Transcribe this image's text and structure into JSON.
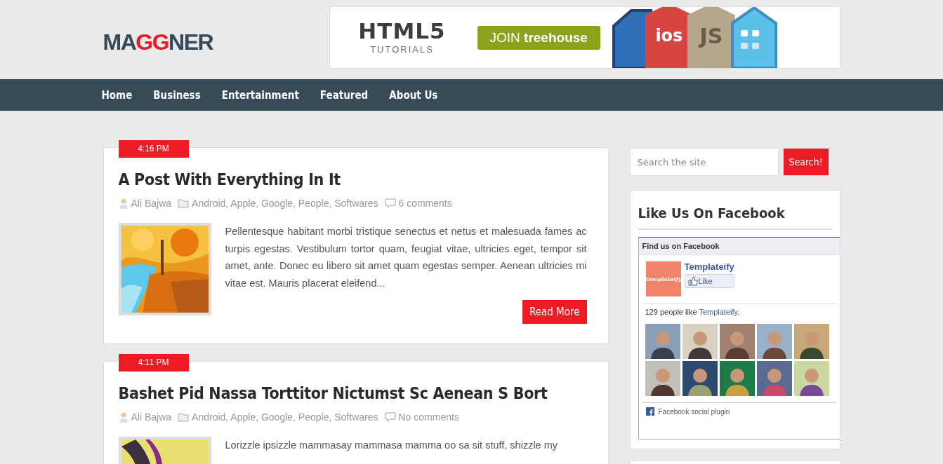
{
  "logo": [
    {
      "text": "MA",
      "accent": false
    },
    {
      "text": "GG",
      "accent": true
    },
    {
      "text": "NER",
      "accent": false
    }
  ],
  "banner": {
    "title": "HTML5",
    "subtitle": "TUTORIALS",
    "button": "JOIN **treehouse**",
    "badges": [
      {
        "text": "ios",
        "color": "#d64541"
      },
      {
        "text": "JS",
        "color": "#b5a68c"
      }
    ]
  },
  "nav": [
    {
      "label": "Home"
    },
    {
      "label": "Business"
    },
    {
      "label": "Entertainment"
    },
    {
      "label": "Featured"
    },
    {
      "label": "About Us"
    }
  ],
  "posts": [
    {
      "time": "4:16 PM",
      "title": "A Post With Everything In It",
      "author": "Ali Bajwa",
      "categories": "Android, Apple, Google, People, Softwares",
      "comments": "6 comments",
      "excerpt": "Pellentesque habitant morbi tristique senectus et netus et malesuada fames ac turpis egestas. Vestibulum tortor quam, feugiat vitae, ultricies eget, tempor sit amet, ante. Donec eu libero sit amet quam egestas semper. Aenean ultricies mi vitae est. Mauris placerat eleifend...",
      "read_more": "Read More",
      "thumb": {
        "kind": "autumn"
      }
    },
    {
      "time": "4:11 PM",
      "title": "Bashet Pid Nassa Torttitor Nictumst Sc Aenean S Bort",
      "author": "Ali Bajwa",
      "categories": "Android, Apple, Google, People, Softwares",
      "comments": "No comments",
      "excerpt": "Lorizzle ipsizzle mammasay mammasa mamma oo sa sit stuff, shizzle my",
      "thumb": {
        "kind": "ribbon"
      }
    }
  ],
  "search": {
    "placeholder": "Search the site",
    "button": "Search!"
  },
  "facebook": {
    "title": "Like Us On Facebook",
    "header": "Find us on Facebook",
    "logo_text": "Templateify",
    "page_name": "Templateify",
    "like": "Like",
    "count_text": "129 people like",
    "count_link": "Templateify",
    "count_end": ".",
    "footer": "Facebook social plugin"
  }
}
